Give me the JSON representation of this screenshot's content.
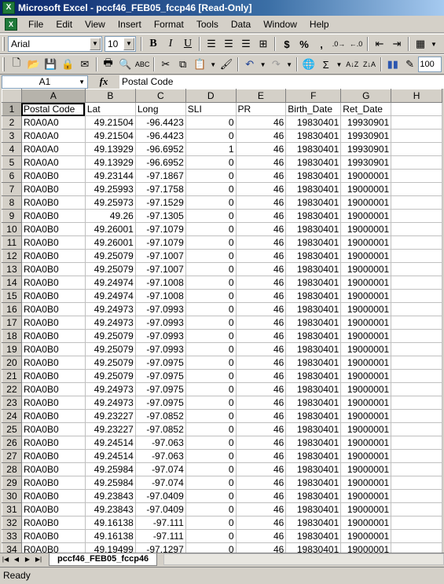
{
  "window": {
    "title": "Microsoft Excel - pccf46_FEB05_fccp46 [Read-Only]"
  },
  "menu": [
    "File",
    "Edit",
    "View",
    "Insert",
    "Format",
    "Tools",
    "Data",
    "Window",
    "Help"
  ],
  "formatting": {
    "font": "Arial",
    "size": "10",
    "zoom": "100"
  },
  "formula_bar": {
    "cell_ref": "A1",
    "fx": "fx",
    "content": "Postal Code"
  },
  "sheet": {
    "columns": [
      "A",
      "B",
      "C",
      "D",
      "E",
      "F",
      "G",
      "H"
    ],
    "rows": [
      [
        "1",
        "Postal Code",
        "Lat",
        "Long",
        "SLI",
        "PR",
        "Birth_Date",
        "Ret_Date",
        ""
      ],
      [
        "2",
        "R0A0A0",
        "49.21504",
        "-96.4423",
        "0",
        "46",
        "19830401",
        "19930901",
        ""
      ],
      [
        "3",
        "R0A0A0",
        "49.21504",
        "-96.4423",
        "0",
        "46",
        "19830401",
        "19930901",
        ""
      ],
      [
        "4",
        "R0A0A0",
        "49.13929",
        "-96.6952",
        "1",
        "46",
        "19830401",
        "19930901",
        ""
      ],
      [
        "5",
        "R0A0A0",
        "49.13929",
        "-96.6952",
        "0",
        "46",
        "19830401",
        "19930901",
        ""
      ],
      [
        "6",
        "R0A0B0",
        "49.23144",
        "-97.1867",
        "0",
        "46",
        "19830401",
        "19000001",
        ""
      ],
      [
        "7",
        "R0A0B0",
        "49.25993",
        "-97.1758",
        "0",
        "46",
        "19830401",
        "19000001",
        ""
      ],
      [
        "8",
        "R0A0B0",
        "49.25973",
        "-97.1529",
        "0",
        "46",
        "19830401",
        "19000001",
        ""
      ],
      [
        "9",
        "R0A0B0",
        "49.26",
        "-97.1305",
        "0",
        "46",
        "19830401",
        "19000001",
        ""
      ],
      [
        "10",
        "R0A0B0",
        "49.26001",
        "-97.1079",
        "0",
        "46",
        "19830401",
        "19000001",
        ""
      ],
      [
        "11",
        "R0A0B0",
        "49.26001",
        "-97.1079",
        "0",
        "46",
        "19830401",
        "19000001",
        ""
      ],
      [
        "12",
        "R0A0B0",
        "49.25079",
        "-97.1007",
        "0",
        "46",
        "19830401",
        "19000001",
        ""
      ],
      [
        "13",
        "R0A0B0",
        "49.25079",
        "-97.1007",
        "0",
        "46",
        "19830401",
        "19000001",
        ""
      ],
      [
        "14",
        "R0A0B0",
        "49.24974",
        "-97.1008",
        "0",
        "46",
        "19830401",
        "19000001",
        ""
      ],
      [
        "15",
        "R0A0B0",
        "49.24974",
        "-97.1008",
        "0",
        "46",
        "19830401",
        "19000001",
        ""
      ],
      [
        "16",
        "R0A0B0",
        "49.24973",
        "-97.0993",
        "0",
        "46",
        "19830401",
        "19000001",
        ""
      ],
      [
        "17",
        "R0A0B0",
        "49.24973",
        "-97.0993",
        "0",
        "46",
        "19830401",
        "19000001",
        ""
      ],
      [
        "18",
        "R0A0B0",
        "49.25079",
        "-97.0993",
        "0",
        "46",
        "19830401",
        "19000001",
        ""
      ],
      [
        "19",
        "R0A0B0",
        "49.25079",
        "-97.0993",
        "0",
        "46",
        "19830401",
        "19000001",
        ""
      ],
      [
        "20",
        "R0A0B0",
        "49.25079",
        "-97.0975",
        "0",
        "46",
        "19830401",
        "19000001",
        ""
      ],
      [
        "21",
        "R0A0B0",
        "49.25079",
        "-97.0975",
        "0",
        "46",
        "19830401",
        "19000001",
        ""
      ],
      [
        "22",
        "R0A0B0",
        "49.24973",
        "-97.0975",
        "0",
        "46",
        "19830401",
        "19000001",
        ""
      ],
      [
        "23",
        "R0A0B0",
        "49.24973",
        "-97.0975",
        "0",
        "46",
        "19830401",
        "19000001",
        ""
      ],
      [
        "24",
        "R0A0B0",
        "49.23227",
        "-97.0852",
        "0",
        "46",
        "19830401",
        "19000001",
        ""
      ],
      [
        "25",
        "R0A0B0",
        "49.23227",
        "-97.0852",
        "0",
        "46",
        "19830401",
        "19000001",
        ""
      ],
      [
        "26",
        "R0A0B0",
        "49.24514",
        "-97.063",
        "0",
        "46",
        "19830401",
        "19000001",
        ""
      ],
      [
        "27",
        "R0A0B0",
        "49.24514",
        "-97.063",
        "0",
        "46",
        "19830401",
        "19000001",
        ""
      ],
      [
        "28",
        "R0A0B0",
        "49.25984",
        "-97.074",
        "0",
        "46",
        "19830401",
        "19000001",
        ""
      ],
      [
        "29",
        "R0A0B0",
        "49.25984",
        "-97.074",
        "0",
        "46",
        "19830401",
        "19000001",
        ""
      ],
      [
        "30",
        "R0A0B0",
        "49.23843",
        "-97.0409",
        "0",
        "46",
        "19830401",
        "19000001",
        ""
      ],
      [
        "31",
        "R0A0B0",
        "49.23843",
        "-97.0409",
        "0",
        "46",
        "19830401",
        "19000001",
        ""
      ],
      [
        "32",
        "R0A0B0",
        "49.16138",
        "-97.111",
        "0",
        "46",
        "19830401",
        "19000001",
        ""
      ],
      [
        "33",
        "R0A0B0",
        "49.16138",
        "-97.111",
        "0",
        "46",
        "19830401",
        "19000001",
        ""
      ],
      [
        "34",
        "R0A0B0",
        "49.19499",
        "-97.1297",
        "0",
        "46",
        "19830401",
        "19000001",
        ""
      ]
    ]
  },
  "tabs": {
    "sheet_name": "pccf46_FEB05_fccp46"
  },
  "status": {
    "text": "Ready"
  }
}
